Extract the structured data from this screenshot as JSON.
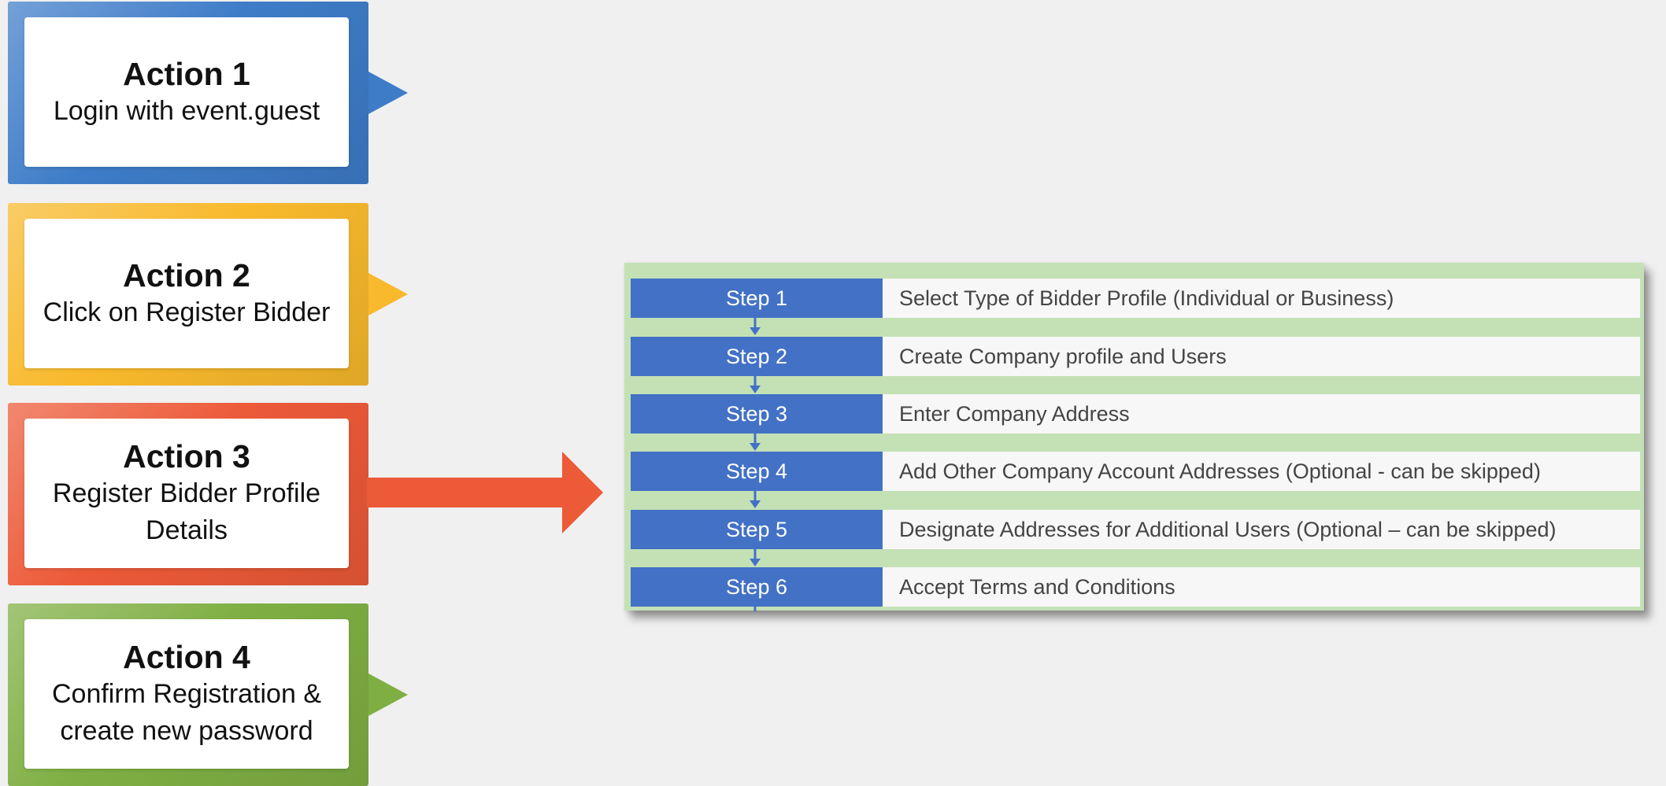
{
  "actions": [
    {
      "title": "Action 1",
      "desc": "Login with event.guest",
      "color": "#3e7cc8"
    },
    {
      "title": "Action 2",
      "desc": "Click on Register Bidder",
      "color": "#f8b92c"
    },
    {
      "title": "Action 3",
      "desc": "Register Bidder Profile Details",
      "color": "#ec5a38"
    },
    {
      "title": "Action 4",
      "desc": "Confirm Registration & create new password",
      "color": "#7faf43"
    }
  ],
  "steps": [
    {
      "label": "Step 1",
      "text": "Select Type of Bidder Profile (Individual or Business)"
    },
    {
      "label": "Step 2",
      "text": "Create Company profile and Users"
    },
    {
      "label": "Step 3",
      "text": "Enter Company Address"
    },
    {
      "label": "Step 4",
      "text": "Add Other Company Account Addresses (Optional - can be skipped)"
    },
    {
      "label": "Step 5",
      "text": "Designate Addresses for Additional Users (Optional – can be skipped)"
    },
    {
      "label": "Step 6",
      "text": "Accept Terms and Conditions"
    }
  ],
  "colors": {
    "step_label_bg": "#4371c6",
    "panel_bg": "#c4e1b5",
    "page_bg": "#f0f0f0"
  }
}
